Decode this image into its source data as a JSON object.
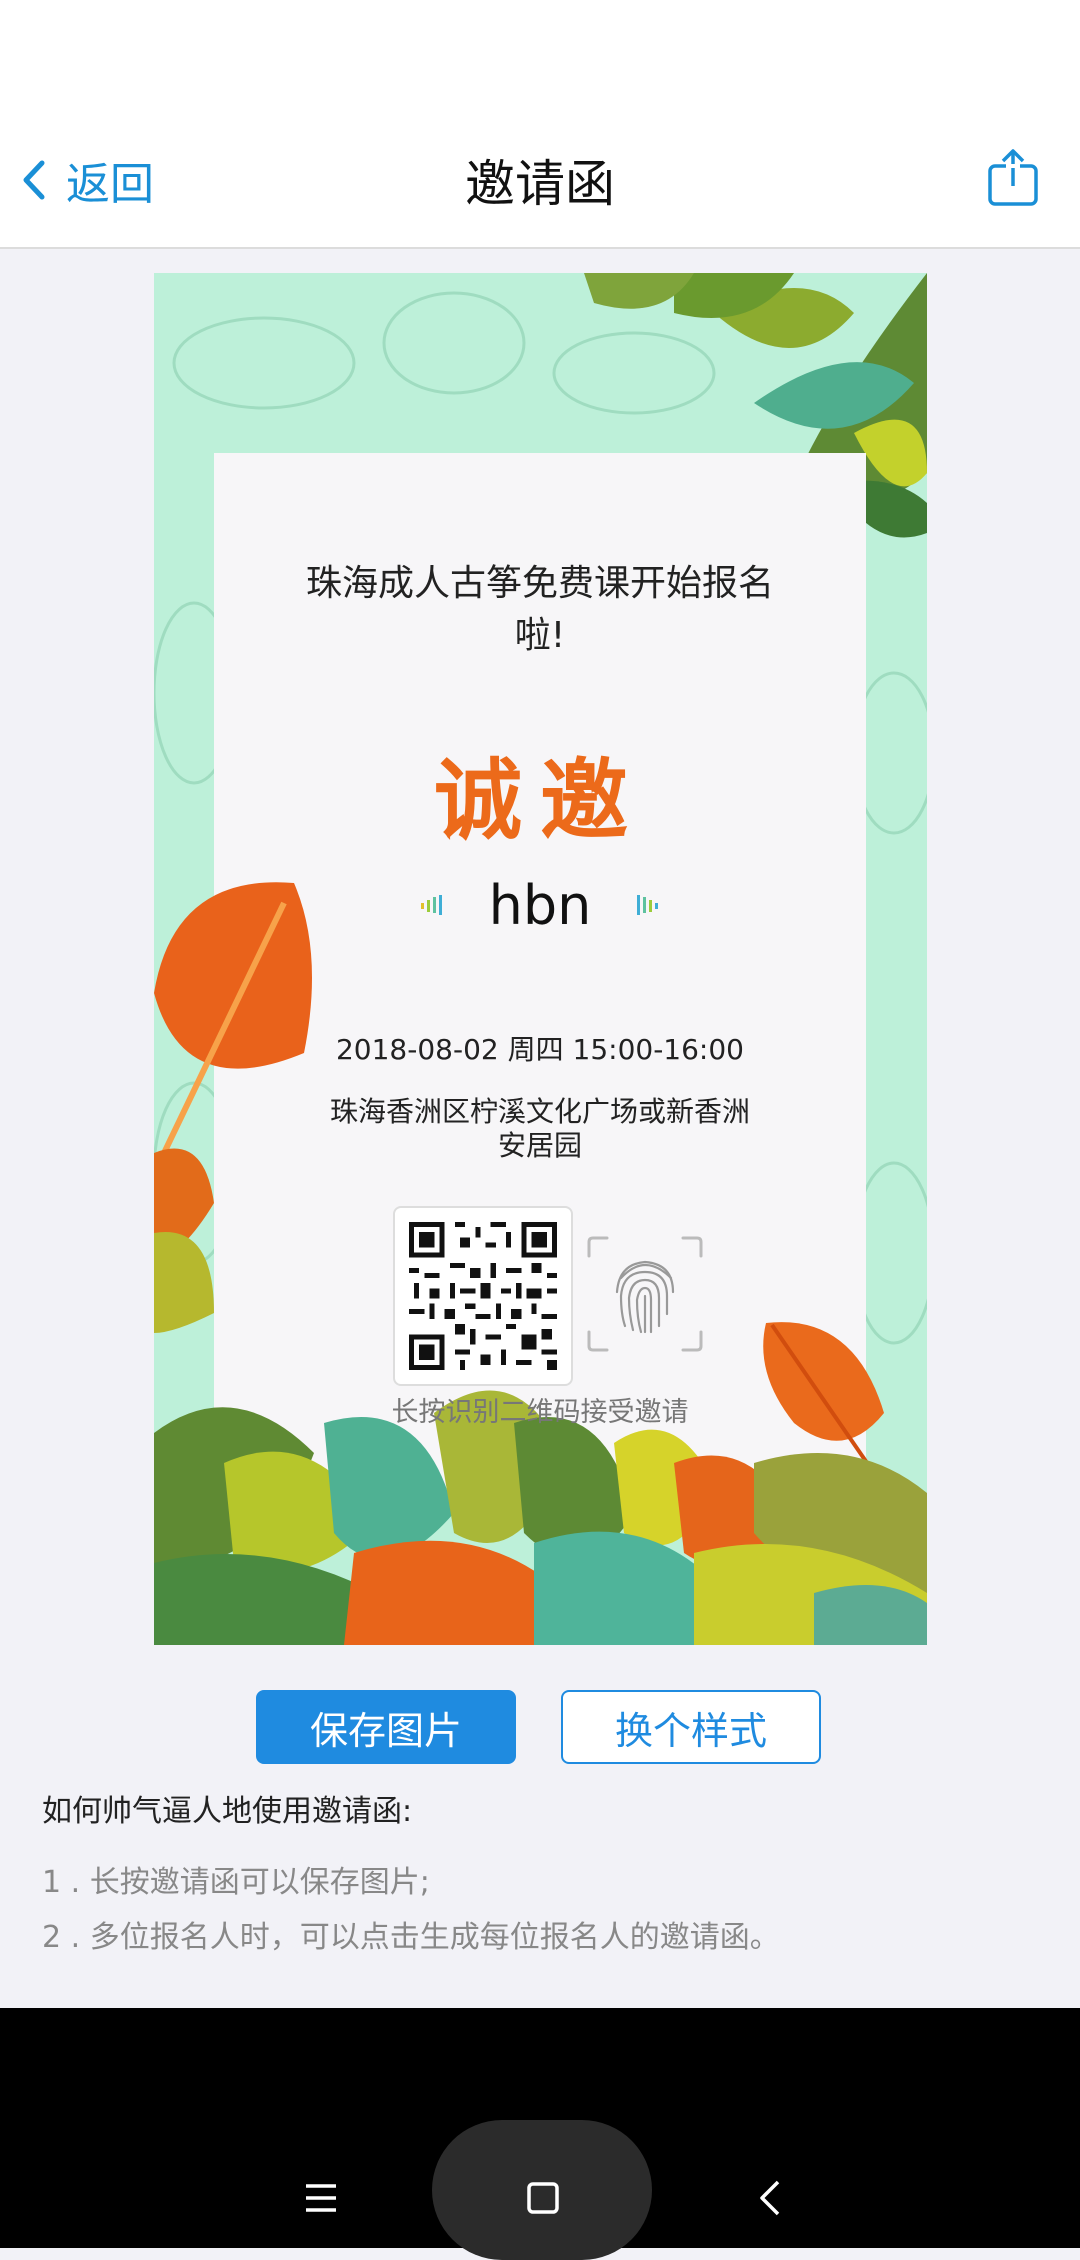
{
  "header": {
    "back_label": "返回",
    "title": "邀请函"
  },
  "invitation": {
    "event_title": "珠海成人古筝免费课开始报名啦!",
    "sincere_text": "诚邀",
    "guest_name": "hbn",
    "datetime": "2018-08-02 周四 15:00-16:00",
    "address": "珠海香洲区柠溪文化广场或新香洲安居园",
    "qr_hint": "长按识别二维码接受邀请"
  },
  "actions": {
    "save_label": "保存图片",
    "change_style_label": "换个样式"
  },
  "help": {
    "title": "如何帅气逼人地使用邀请函:",
    "items": [
      "1 . 长按邀请函可以保存图片;",
      "2 . 多位报名人时，可以点击生成每位报名人的邀请函。"
    ]
  },
  "colors": {
    "accent": "#1f8be0",
    "card_bg": "#bdf0d9",
    "sincere": "#ec6a1a"
  },
  "icons": [
    "chevron-left-icon",
    "share-icon",
    "qr-code",
    "fingerprint-icon",
    "sound-wave-icon",
    "menu-icon",
    "home-icon",
    "back-icon"
  ]
}
